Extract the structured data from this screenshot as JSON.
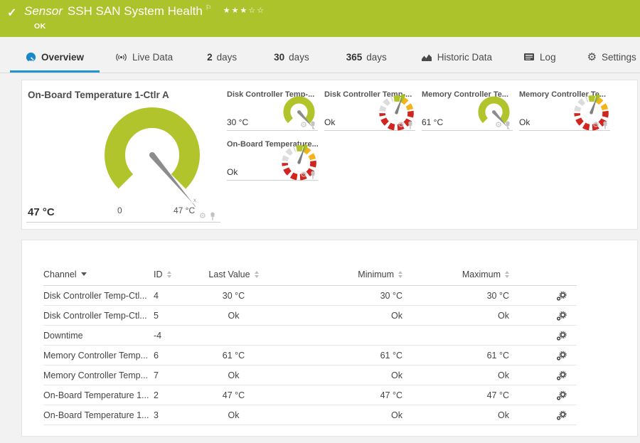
{
  "header": {
    "status_icon": "✓",
    "type_label": "Sensor",
    "title": "SSH SAN System Health",
    "flag_icon": "⚐",
    "stars": "★★★☆☆",
    "status": "OK"
  },
  "tabs": [
    {
      "label": "Overview",
      "icon": "gauge-icon",
      "active": true
    },
    {
      "label": "Live Data",
      "icon": "broadcast-icon"
    },
    {
      "num": "2",
      "label": "days"
    },
    {
      "num": "30",
      "label": "days"
    },
    {
      "num": "365",
      "label": "days"
    },
    {
      "label": "Historic Data",
      "icon": "area-chart-icon"
    },
    {
      "label": "Log",
      "icon": "log-icon"
    },
    {
      "label": "Settings",
      "icon": "gear-icon",
      "gear_glyph": "⚙"
    }
  ],
  "main_gauge": {
    "title": "On-Board Temperature 1-Ctlr A",
    "value": "47 °C",
    "scale_min": "0",
    "scale_max": "47 °C",
    "needle_tip_mark": "x",
    "gear_glyph": "⚙"
  },
  "minis": [
    {
      "title": "Disk Controller Temp-...",
      "value": "30 °C",
      "gauge_type": "radial",
      "gear_glyph": "⚙"
    },
    {
      "title": "Disk Controller Temp-...",
      "value": "Ok",
      "gauge_type": "segmented",
      "gear_glyph": "⚙"
    },
    {
      "title": "Memory Controller Te...",
      "value": "61 °C",
      "gauge_type": "radial",
      "gear_glyph": "⚙"
    },
    {
      "title": "Memory Controller Te...",
      "value": "Ok",
      "gauge_type": "segmented",
      "gear_glyph": "⚙"
    },
    {
      "title": "On-Board Temperature...",
      "value": "Ok",
      "gauge_type": "segmented",
      "gear_glyph": "⚙"
    }
  ],
  "table": {
    "headers": {
      "channel": "Channel",
      "id": "ID",
      "last": "Last Value",
      "min": "Minimum",
      "max": "Maximum"
    },
    "rows": [
      {
        "channel": "Disk Controller Temp-Ctl...",
        "id": "4",
        "last": "30 °C",
        "min": "30 °C",
        "max": "30 °C"
      },
      {
        "channel": "Disk Controller Temp-Ctl...",
        "id": "5",
        "last": "Ok",
        "min": "Ok",
        "max": "Ok"
      },
      {
        "channel": "Downtime",
        "id": "-4",
        "last": "",
        "min": "",
        "max": ""
      },
      {
        "channel": "Memory Controller Temp...",
        "id": "6",
        "last": "61 °C",
        "min": "61 °C",
        "max": "61 °C"
      },
      {
        "channel": "Memory Controller Temp...",
        "id": "7",
        "last": "Ok",
        "min": "Ok",
        "max": "Ok"
      },
      {
        "channel": "On-Board Temperature 1...",
        "id": "2",
        "last": "47 °C",
        "min": "47 °C",
        "max": "47 °C"
      },
      {
        "channel": "On-Board Temperature 1...",
        "id": "3",
        "last": "Ok",
        "min": "Ok",
        "max": "Ok"
      }
    ]
  },
  "colors": {
    "status_up_green": "#adc32b",
    "gauge_green": "#b2c42c",
    "gauge_red": "#d0261f",
    "gauge_yellow": "#f5b31b",
    "gauge_gray": "#dcdcdc",
    "needle_gray": "#8c8c8c",
    "tab_accent_blue": "#2196cc"
  }
}
